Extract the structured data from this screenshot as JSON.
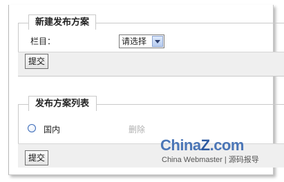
{
  "new_plan": {
    "legend": "新建发布方案",
    "field_label": "栏目：",
    "select_value": "请选择",
    "submit_label": "提交"
  },
  "plan_list": {
    "legend": "发布方案列表",
    "items": [
      {
        "name": "国内",
        "action": "删除"
      }
    ],
    "submit_label": "提交"
  },
  "watermark": {
    "brand_prefix": "China",
    "brand_z": "Z",
    "brand_suffix": ".com",
    "tagline": "China Webmaster | 源码报导"
  }
}
